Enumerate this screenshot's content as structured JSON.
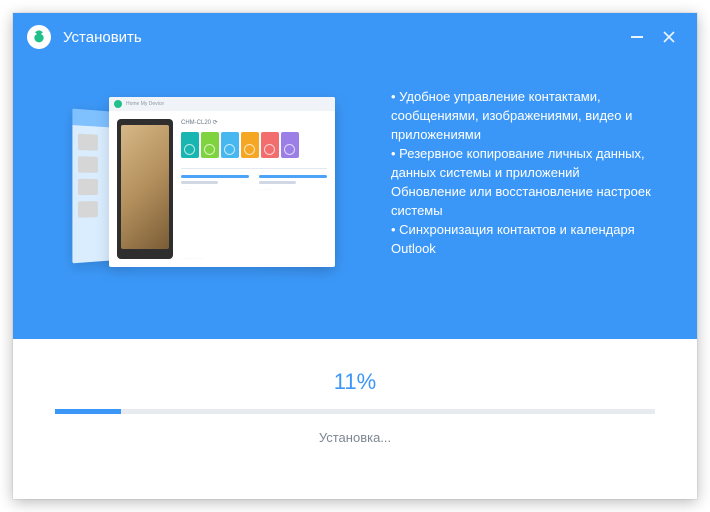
{
  "window": {
    "title": "Установить"
  },
  "features": {
    "items": [
      "• Удобное управление контактами, сообщениями, изображениями, видео и приложениями",
      "• Резервное копирование личных данных, данных системы и приложений",
      "Обновление или восстановление настроек системы",
      "• Синхронизация контактов и календаря Outlook"
    ]
  },
  "illustration": {
    "app_bar_label": "Home    My Device",
    "model_name": "CHM-CL20 ⟳"
  },
  "progress": {
    "percent_label": "11%",
    "percent_value": 11,
    "status_text": "Установка..."
  },
  "colors": {
    "accent": "#3b97f7"
  }
}
